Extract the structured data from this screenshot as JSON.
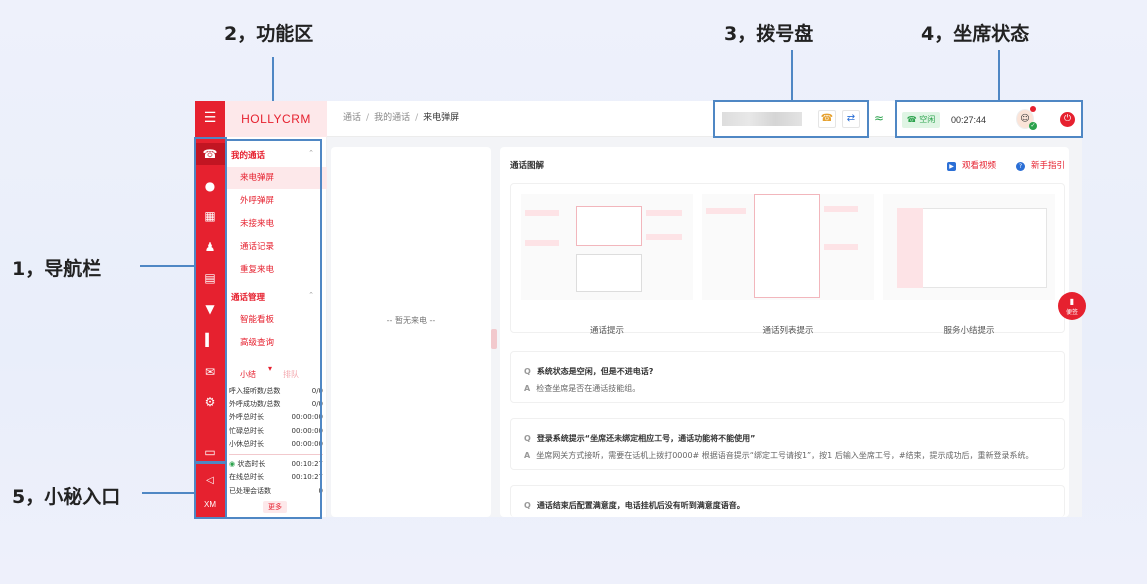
{
  "annotations": {
    "functions": "2，功能区",
    "dialpad": "3，拨号盘",
    "seat_status": "4，坐席状态",
    "navbar": "1，导航栏",
    "secretary": "5，小秘入口"
  },
  "app": {
    "brand": "HOLLYCRM",
    "breadcrumb": [
      "通话",
      "我的通话",
      "来电弹屏"
    ],
    "dialpad": {
      "placeholder": ""
    },
    "seat": {
      "state": "空闲",
      "timer": "00:27:44"
    }
  },
  "nav": {
    "icons": [
      "phone-icon",
      "chat-icon",
      "grid-icon",
      "user-icon",
      "clipboard-icon",
      "shield-icon",
      "chart-icon",
      "message-icon",
      "gear-icon",
      "book-icon"
    ],
    "bottom": {
      "speaker": "speaker-icon",
      "label": "XM"
    }
  },
  "func": {
    "group1": "我的通话",
    "items1": [
      "来电弹屏",
      "外呼弹屏",
      "未接来电",
      "通话记录",
      "重复来电"
    ],
    "group2": "通话管理",
    "items2": [
      "智能看板",
      "高级查询"
    ],
    "tabs": [
      "小结",
      "排队"
    ],
    "stats": [
      {
        "label": "呼入接听数/总数",
        "value": "0/0"
      },
      {
        "label": "外呼成功数/总数",
        "value": "0/0"
      },
      {
        "label": "外呼总时长",
        "value": "00:00:00"
      },
      {
        "label": "忙碌总时长",
        "value": "00:00:00"
      },
      {
        "label": "小休总时长",
        "value": "00:00:00"
      },
      {
        "label": "状态时长",
        "value": "00:10:27"
      },
      {
        "label": "在线总时长",
        "value": "00:10:27"
      },
      {
        "label": "已处理会话数",
        "value": "0"
      }
    ],
    "more": "更多"
  },
  "left_panel": {
    "empty": "-- 暂无来电 --"
  },
  "main": {
    "title": "通话图解",
    "link_video": "观看视频",
    "link_guide": "新手指引",
    "cards": [
      "通话提示",
      "通话列表提示",
      "服务小结提示"
    ],
    "faqs": [
      {
        "q": "系统状态是空闲，但是不进电话?",
        "a": "检查坐席是否在通话技能组。"
      },
      {
        "q": "登录系统提示“坐席还未绑定相应工号，通话功能将不能使用”",
        "a": "坐席网关方式接听，需要在话机上拨打0000# 根据语音提示“绑定工号请按1”，按1 后输入坐席工号，#结束，提示成功后，重新登录系统。"
      },
      {
        "q": "通话结束后配置满意度，电话挂机后没有听到满意度语音。",
        "a": ""
      }
    ],
    "float": "便签",
    "qa_q": "Q",
    "qa_a": "A"
  },
  "colors": {
    "brand_red": "#e6212f",
    "annotation_blue": "#4f87c4",
    "status_green": "#2ba24c"
  }
}
